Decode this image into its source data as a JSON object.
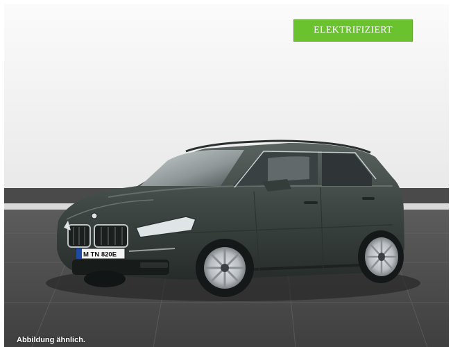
{
  "badge": {
    "label": "ELEKTRIFIZIERT",
    "color": "#6ac22e"
  },
  "car": {
    "license_plate": "M TN 820E",
    "paint_color": "#3c4441"
  },
  "caption": {
    "text": "Abbildung ähnlich."
  }
}
